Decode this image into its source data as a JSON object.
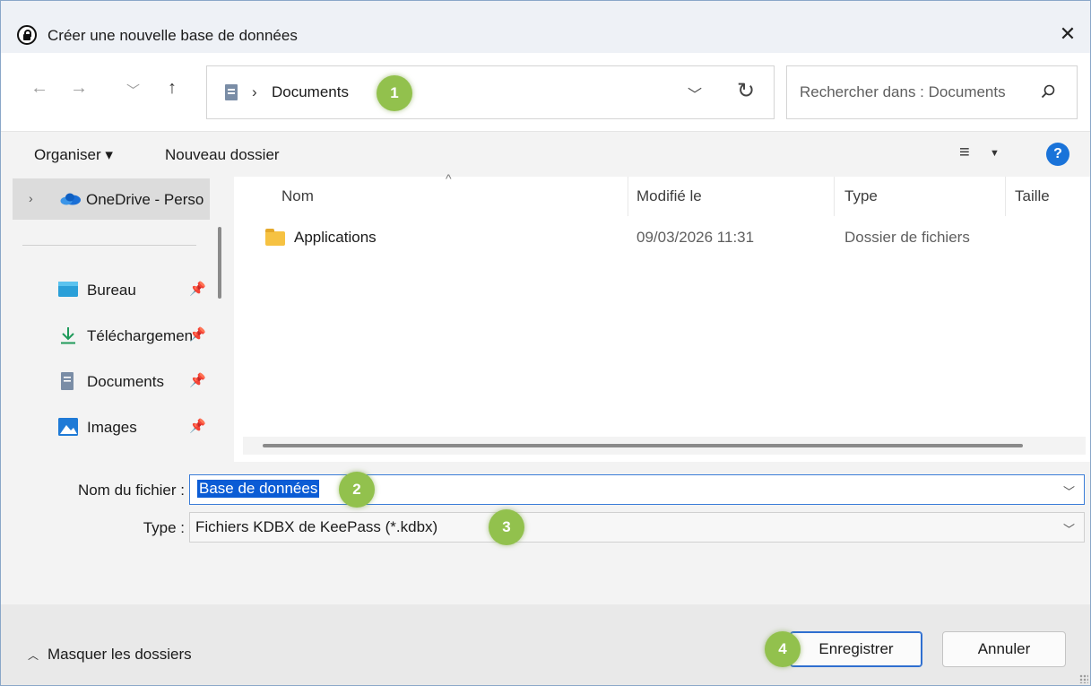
{
  "window": {
    "title": "Créer une nouvelle base de données"
  },
  "nav": {
    "back_icon": "arrow-left-icon",
    "forward_icon": "arrow-right-icon",
    "recent_icon": "chevron-down-icon",
    "up_icon": "arrow-up-icon",
    "address": {
      "separator": "›",
      "path": "Documents"
    },
    "search": {
      "placeholder": "Rechercher dans : Documents"
    }
  },
  "toolbar": {
    "organise_label": "Organiser ▾",
    "new_folder_label": "Nouveau dossier"
  },
  "sidebar": {
    "onedrive_label": "OneDrive - Perso",
    "items": [
      {
        "label": "Bureau",
        "icon": "desktop-icon"
      },
      {
        "label": "Téléchargements",
        "icon": "download-icon"
      },
      {
        "label": "Documents",
        "icon": "document-icon"
      },
      {
        "label": "Images",
        "icon": "images-icon"
      }
    ]
  },
  "filelist": {
    "columns": [
      "Nom",
      "Modifié le",
      "Type",
      "Taille"
    ],
    "rows": [
      {
        "name": "Applications",
        "modified": "09/03/2026 11:31",
        "type": "Dossier de fichiers",
        "size": ""
      }
    ]
  },
  "form": {
    "filename_label": "Nom du fichier :",
    "filename_value": "Base de données",
    "type_label": "Type :",
    "type_value": "Fichiers KDBX de KeePass (*.kdbx)"
  },
  "footer": {
    "hide_folders_label": "Masquer les dossiers",
    "save_label": "Enregistrer",
    "cancel_label": "Annuler"
  },
  "annotations": [
    "1",
    "2",
    "3",
    "4"
  ],
  "colors": {
    "accent": "#0b5cd5",
    "badge": "#92c14d",
    "help": "#1a73d9",
    "folder": "#f6c242"
  }
}
